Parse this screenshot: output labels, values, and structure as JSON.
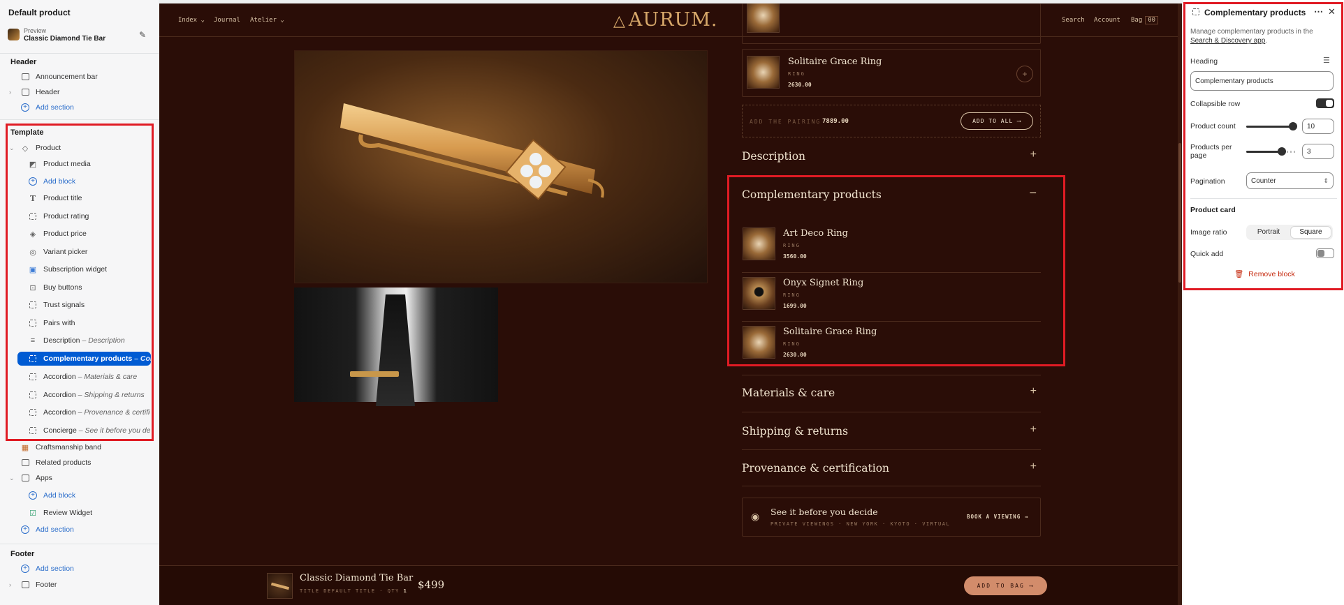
{
  "left_panel": {
    "title": "Default product",
    "preview_label": "Preview",
    "preview_value": "Classic Diamond Tie Bar",
    "header_group": {
      "title": "Header",
      "items": [
        "Announcement bar",
        "Header"
      ],
      "add_section": "Add section"
    },
    "template": {
      "title": "Template",
      "product_label": "Product",
      "blocks": [
        {
          "label": "Product media",
          "sub": ""
        },
        {
          "label": "Add block",
          "sub": ""
        },
        {
          "label": "Product title",
          "sub": ""
        },
        {
          "label": "Product rating",
          "sub": ""
        },
        {
          "label": "Product price",
          "sub": ""
        },
        {
          "label": "Variant picker",
          "sub": ""
        },
        {
          "label": "Subscription widget",
          "sub": ""
        },
        {
          "label": "Buy buttons",
          "sub": ""
        },
        {
          "label": "Trust signals",
          "sub": ""
        },
        {
          "label": "Pairs with",
          "sub": ""
        },
        {
          "label": "Description",
          "sub": "– Description"
        },
        {
          "label": "Complementary products",
          "sub": "– Compl..."
        },
        {
          "label": "Accordion",
          "sub": "– Materials & care"
        },
        {
          "label": "Accordion",
          "sub": "– Shipping & returns"
        },
        {
          "label": "Accordion",
          "sub": "– Provenance & certific..."
        },
        {
          "label": "Concierge",
          "sub": "– See it before you deci..."
        }
      ],
      "sections": [
        "Craftsmanship band",
        "Related products"
      ],
      "apps_label": "Apps",
      "apps_add_block": "Add block",
      "apps_items": [
        "Review Widget"
      ],
      "add_section": "Add section"
    },
    "footer_group": {
      "title": "Footer",
      "add_section": "Add section",
      "items": [
        "Footer"
      ]
    }
  },
  "storefront": {
    "nav_left": [
      "Index",
      "Journal",
      "Atelier"
    ],
    "logo": "AURUM.",
    "nav_right": [
      "Search",
      "Account",
      "Bag"
    ],
    "bag_count": "00",
    "pairing_products": [
      {
        "name": "Solitaire Grace Ring",
        "category": "RING",
        "price": "2630.00"
      }
    ],
    "add_pairing_label": "ADD THE PAIRING",
    "add_pairing_total": "7889.00",
    "add_to_all": "ADD TO ALL",
    "accordions": {
      "description": "Description",
      "complementary": "Complementary products",
      "materials": "Materials & care",
      "shipping": "Shipping & returns",
      "provenance": "Provenance & certification"
    },
    "complementary_products": [
      {
        "name": "Art Deco Ring",
        "category": "RING",
        "price": "3560.00"
      },
      {
        "name": "Onyx Signet Ring",
        "category": "RING",
        "price": "1699.00"
      },
      {
        "name": "Solitaire Grace Ring",
        "category": "RING",
        "price": "2630.00"
      }
    ],
    "concierge": {
      "title": "See it before you decide",
      "tags": [
        "PRIVATE VIEWINGS",
        "NEW YORK",
        "KYOTO",
        "VIRTUAL"
      ],
      "cta": "BOOK A VIEWING"
    },
    "sticky_bar": {
      "title": "Classic Diamond Tie Bar",
      "variant": "TITLE DEFAULT TITLE",
      "qty_label": "QTY",
      "qty": "1",
      "price": "$499",
      "cta": "ADD TO BAG"
    }
  },
  "right_panel": {
    "title": "Complementary products",
    "help_text": "Manage complementary products in the",
    "help_link": "Search & Discovery app",
    "heading_label": "Heading",
    "heading_value": "Complementary products",
    "collapsible_label": "Collapsible row",
    "collapsible_on": true,
    "product_count_label": "Product count",
    "product_count_value": "10",
    "product_count_fraction": 1.0,
    "per_page_label": "Products per page",
    "per_page_value": "3",
    "pagination_label": "Pagination",
    "pagination_value": "Counter",
    "product_card_title": "Product card",
    "image_ratio_label": "Image ratio",
    "image_ratio_options": [
      "Portrait",
      "Square"
    ],
    "image_ratio_selected": "Square",
    "quick_add_label": "Quick add",
    "quick_add_on": false,
    "remove_block": "Remove block"
  },
  "colors": {
    "selected_blue": "#005bd3",
    "highlight_red": "#e01b24",
    "store_bg": "#2a0d07",
    "accent_gold": "#d7a86a",
    "cta_peach": "#d28c6b"
  }
}
